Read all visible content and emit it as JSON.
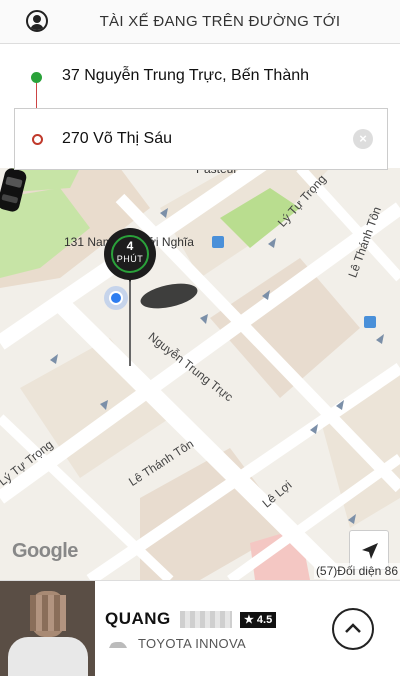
{
  "header": {
    "title": "TÀI XẾ ĐANG TRÊN ĐƯỜNG TỚI",
    "profile_icon": "user-circle-icon"
  },
  "route": {
    "origin": "37 Nguyễn Trung Trực, Bến Thành",
    "destination": "270 Võ Thị Sáu",
    "clear_icon": "clear-icon",
    "origin_color": "#2aa23a",
    "destination_color": "#c0392b"
  },
  "map": {
    "pin": {
      "minutes": "4",
      "unit": "PHÚT"
    },
    "poi_label": "131 Nam Kỳ Khởi Nghĩa",
    "place_top": "Pasteur",
    "streets": {
      "nguyen_trung_truc": "Nguyễn Trung Trực",
      "ly_tu_trong_top": "Lý Tự Trọng",
      "le_thanh_ton_right": "Lê Thánh Tôn",
      "ly_tu_trong_left": "Lý Tự Trọng",
      "le_thanh_ton": "Lê Thánh Tôn",
      "le_loi": "Lê Lợi"
    },
    "attribution": "Google",
    "address_strip": "(57)Đối diện 86",
    "locate_icon": "navigation-arrow-icon"
  },
  "driver": {
    "name": "QUANG",
    "rating": "★ 4.5",
    "car_model": "TOYOTA INNOVA",
    "expand_icon": "chevron-up-icon"
  }
}
